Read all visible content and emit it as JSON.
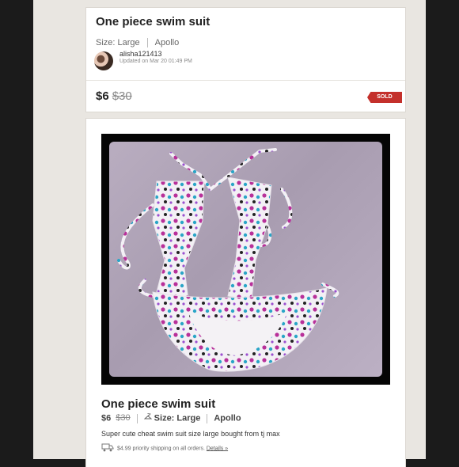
{
  "header_card": {
    "title": "One piece swim suit",
    "size": "Size: Large",
    "brand": "Apollo",
    "username": "alisha121413",
    "updated": "Updated on Mar 20 01:49 PM",
    "price": "$6",
    "original_price": "$30",
    "status_badge": "SOLD"
  },
  "listing": {
    "title": "One piece swim suit",
    "price": "$6",
    "original_price": "$30",
    "size": "Size: Large",
    "brand": "Apollo",
    "description": "Super cute cheat swim suit size large bought from tj max",
    "shipping_text": "$4.99 priority shipping on all orders.",
    "details_link": "Details »"
  },
  "colors": {
    "sold_badge": "#c4302b",
    "page_background": "#e9e6e1"
  },
  "icons": [
    "hanger-icon",
    "truck-icon"
  ]
}
